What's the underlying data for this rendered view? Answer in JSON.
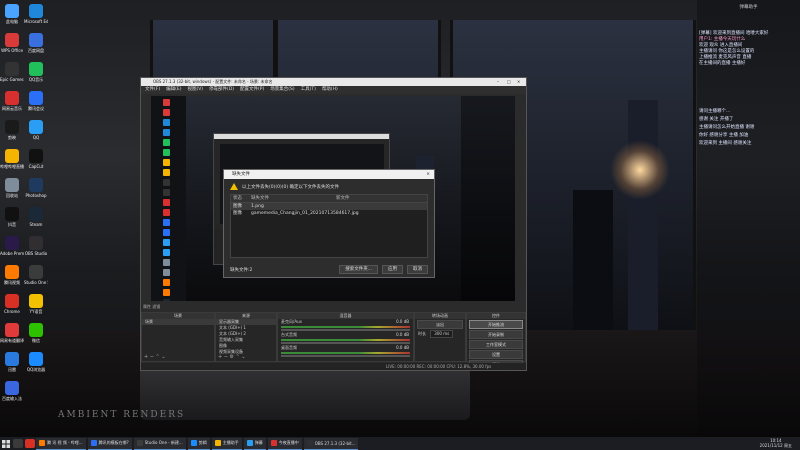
{
  "desktop": {
    "icons": [
      {
        "label": "此电脑",
        "color": "#4aa3ff"
      },
      {
        "label": "Microsoft Edge",
        "color": "#1f88d9"
      },
      {
        "label": "WPS Office",
        "color": "#d93a3a"
      },
      {
        "label": "百度网盘",
        "color": "#3a6fe0"
      },
      {
        "label": "Epic Games Launcher",
        "color": "#333333"
      },
      {
        "label": "QQ音乐",
        "color": "#21c05b"
      },
      {
        "label": "网易云音乐",
        "color": "#d8302f"
      },
      {
        "label": "腾讯会议",
        "color": "#2a6ff5"
      },
      {
        "label": "剪映",
        "color": "#1a1a1a"
      },
      {
        "label": "QQ",
        "color": "#2a9df4"
      },
      {
        "label": "哔哩哔哩直播姬",
        "color": "#f5b400"
      },
      {
        "label": "CapCut",
        "color": "#111111"
      },
      {
        "label": "回收站",
        "color": "#7f8c99"
      },
      {
        "label": "Photoshop",
        "color": "#1e3a5f"
      },
      {
        "label": "抖音",
        "color": "#111111"
      },
      {
        "label": "Steam",
        "color": "#1b2838"
      },
      {
        "label": "Adobe Premiere Pro",
        "color": "#2a1a4a"
      },
      {
        "label": "OBS Studio",
        "color": "#302e31"
      },
      {
        "label": "腾讯视频",
        "color": "#ff7a00"
      },
      {
        "label": "Studio One 5",
        "color": "#3b3b3b"
      },
      {
        "label": "Chrome",
        "color": "#d93025"
      },
      {
        "label": "YY语音",
        "color": "#f2c200"
      },
      {
        "label": "网易有道翻译",
        "color": "#e03a3a"
      },
      {
        "label": "微信",
        "color": "#2dc100"
      },
      {
        "label": "迅雷",
        "color": "#2a7be0"
      },
      {
        "label": "QQ浏览器",
        "color": "#1a8cff"
      },
      {
        "label": "百度输入法",
        "color": "#3a66e0"
      }
    ],
    "watermark": "AMBIENT RENDERS"
  },
  "obs": {
    "title": "OBS 27.1.3 (32-bit, windows) - 配置文件: 未命名 - 场景: 未命名",
    "menu": [
      "文件(F)",
      "编辑(E)",
      "视图(V)",
      "停靠部件(D)",
      "配置文件(P)",
      "场景集合(S)",
      "工具(T)",
      "帮助(H)"
    ],
    "preview_icon_colors": [
      "#d93a3a",
      "#1f88d9",
      "#21c05b",
      "#f5b400",
      "#333333",
      "#d8302f",
      "#2a6ff5",
      "#2a9df4",
      "#7f8c99",
      "#ff7a00",
      "#1b2838",
      "#2dc100"
    ],
    "docks": {
      "scenes": {
        "title": "场景",
        "item": "场景"
      },
      "sources": {
        "title": "来源",
        "items": [
          "显示器采集",
          "文本 (GDI+) 1",
          "文本 (GDI+) 2",
          "音频输入采集",
          "图像",
          "视频采集设备"
        ]
      },
      "mixer": {
        "title": "混音器",
        "channels": [
          {
            "name": "麦克风/Aux",
            "level": "0.0 dB"
          },
          {
            "name": "台式音频",
            "level": "0.0 dB"
          },
          {
            "name": "桌面音频",
            "level": "0.0 dB"
          }
        ]
      },
      "transitions": {
        "title": "转场动画",
        "type": "淡出",
        "duration_label": "时长",
        "duration": "300 ms"
      },
      "controls": {
        "title": "控件",
        "buttons": [
          "开始推流",
          "开始录制",
          "工作室模式",
          "设置",
          "退出"
        ]
      }
    },
    "source_toolbar": "属性  滤镜",
    "statusbar": "LIVE: 00:00:00   REC: 00:00:00   CPU: 12.8%, 30.00 fps"
  },
  "dialog": {
    "title": "缺失文件",
    "message": "以上文件丢失(0)(0)(0) 确定以下文件丢失的文件",
    "columns": [
      "状态",
      "缺失文件",
      "新文件"
    ],
    "rows": [
      {
        "status": "图像",
        "file": "1.png",
        "new": ""
      },
      {
        "status": "图像",
        "file": "gamemedia_Changjin_01_20210713584617.jpg",
        "new": ""
      }
    ],
    "footer_label": "缺失文件:2",
    "buttons": [
      "搜索文件夹...",
      "应用",
      "取消"
    ]
  },
  "side_panel": {
    "title": "弹幕助手",
    "lines": [
      "[弹幕] 欢迎来到直播间 哈喽大家好",
      "用户1: 主播今天玩什么",
      "欢迎 观众 进入直播间",
      "主播请问 你这是怎么设置的",
      "上播推流 麦克风声音 直播",
      "在主播间的直播 主播好",
      "请问主播哪个...",
      "感谢 关注 开播了",
      "主播请问怎么开始直播 谢谢",
      "你好 感谢分享 主播 加油",
      "欢迎来到 主播间 感谢关注"
    ]
  },
  "taskbar": {
    "items": [
      {
        "label": "腾 讯 视 频 - 哔哩...",
        "color": "#ff7a00"
      },
      {
        "label": "腾讯的模板在哪?",
        "color": "#2a6ff5"
      },
      {
        "label": "Studio One - 新建...",
        "color": "#3b3b3b"
      },
      {
        "label": "剪辑",
        "color": "#1a8cff"
      },
      {
        "label": "主播助手",
        "color": "#f5b400"
      },
      {
        "label": "弹幕",
        "color": "#2a9df4"
      },
      {
        "label": "今夜直播中",
        "color": "#d8302f"
      },
      {
        "label": "OBS 27.1.3 (32-bit...",
        "color": "#302e31"
      }
    ],
    "time": "10:14",
    "date": "2021/11/12 周五"
  }
}
